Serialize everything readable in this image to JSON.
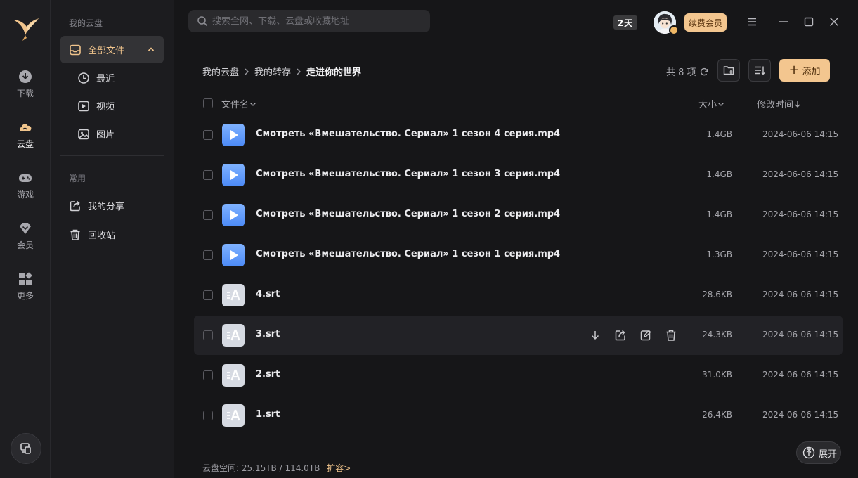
{
  "rail": {
    "items": [
      {
        "label": "下载",
        "icon": "download-circle-icon"
      },
      {
        "label": "云盘",
        "icon": "cloud-icon"
      },
      {
        "label": "游戏",
        "icon": "gamepad-icon"
      },
      {
        "label": "会员",
        "icon": "diamond-icon"
      },
      {
        "label": "更多",
        "icon": "grid-more-icon"
      }
    ]
  },
  "sidebar": {
    "cloud_title": "我的云盘",
    "all_files": "全部文件",
    "recent": "最近",
    "video": "视频",
    "image": "图片",
    "common_title": "常用",
    "my_share": "我的分享",
    "recycle": "回收站"
  },
  "topbar": {
    "search_placeholder": "搜索全网、下载、云盘或收藏地址",
    "days_badge": "2天",
    "renew_label": "续费会员"
  },
  "breadcrumb": [
    "我的云盘",
    "我的转存",
    "走进你的世界"
  ],
  "count_text": "共 8 项",
  "add_label": "添加",
  "table": {
    "col_name": "文件名",
    "col_size": "大小",
    "col_time": "修改时间"
  },
  "files": [
    {
      "type": "video",
      "name": "Смотреть «Вмешательство. Сериал» 1 сезон 4 серия.mp4",
      "size": "1.4GB",
      "time": "2024-06-06 14:15"
    },
    {
      "type": "video",
      "name": "Смотреть «Вмешательство. Сериал» 1 сезон 3 серия.mp4",
      "size": "1.4GB",
      "time": "2024-06-06 14:15"
    },
    {
      "type": "video",
      "name": "Смотреть «Вмешательство. Сериал» 1 сезон 2 серия.mp4",
      "size": "1.4GB",
      "time": "2024-06-06 14:15"
    },
    {
      "type": "video",
      "name": "Смотреть «Вмешательство. Сериал» 1 сезон 1 серия.mp4",
      "size": "1.3GB",
      "time": "2024-06-06 14:15"
    },
    {
      "type": "srt",
      "name": "4.srt",
      "size": "28.6KB",
      "time": "2024-06-06 14:15"
    },
    {
      "type": "srt",
      "name": "3.srt",
      "size": "24.3KB",
      "time": "2024-06-06 14:15"
    },
    {
      "type": "srt",
      "name": "2.srt",
      "size": "31.0KB",
      "time": "2024-06-06 14:15"
    },
    {
      "type": "srt",
      "name": "1.srt",
      "size": "26.4KB",
      "time": "2024-06-06 14:15"
    }
  ],
  "footer": {
    "storage_label": "云盘空间:",
    "storage_value": "25.15TB / 114.0TB",
    "expand_label": "扩容>",
    "unfold_label": "展开"
  },
  "colors": {
    "accent": "#f3c68f",
    "active_text": "#f0c48c",
    "video_icon": "#4c8af6"
  }
}
